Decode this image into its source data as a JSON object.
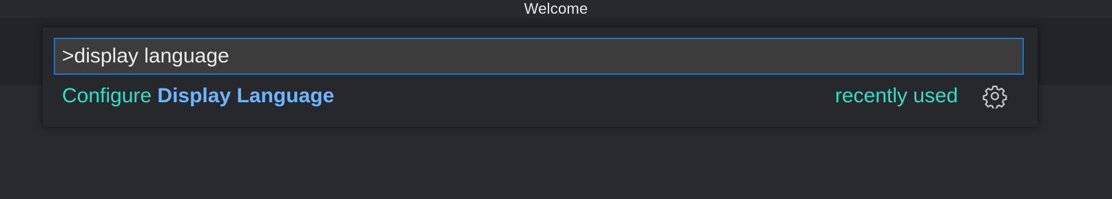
{
  "window": {
    "title": "Welcome"
  },
  "quick_open": {
    "input_value": ">display language",
    "result": {
      "prefix": "Configure ",
      "highlight": "Display Language",
      "badge": "recently used",
      "action_icon": "gear-icon"
    }
  },
  "colors": {
    "background": "#282a2e",
    "focus_border": "#1a76c8",
    "result_text": "#2ee0c6",
    "match_highlight": "#6cb6ff"
  }
}
